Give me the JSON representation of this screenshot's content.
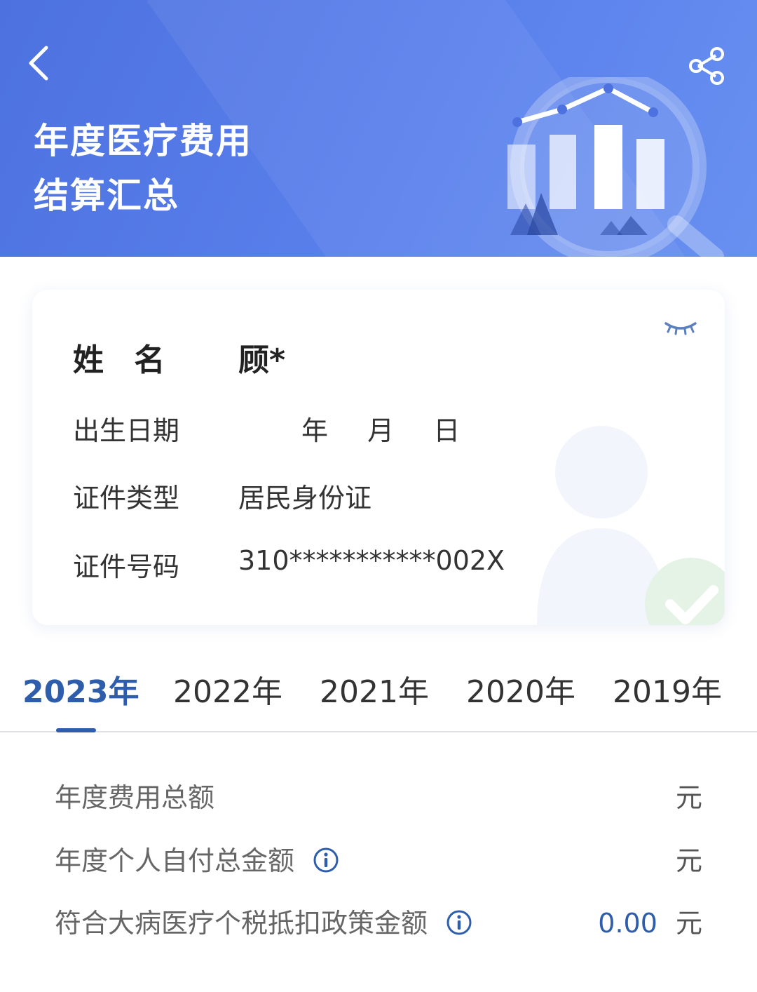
{
  "header": {
    "title_line1": "年度医疗费用",
    "title_line2": "结算汇总",
    "back_icon": "chevron-left-icon",
    "share_icon": "share-icon"
  },
  "profile": {
    "name_label": "姓 名",
    "name_value": "顾*",
    "birth_label": "出生日期",
    "birth_year": "年",
    "birth_month": "月",
    "birth_day": "日",
    "id_type_label": "证件类型",
    "id_type_value": "居民身份证",
    "id_number_label": "证件号码",
    "id_number_value": "310***********002X",
    "visibility_icon": "eye-closed-icon"
  },
  "tabs": [
    {
      "label": "2023年",
      "active": true
    },
    {
      "label": "2022年",
      "active": false
    },
    {
      "label": "2021年",
      "active": false
    },
    {
      "label": "2020年",
      "active": false
    },
    {
      "label": "2019年",
      "active": false
    }
  ],
  "summary": [
    {
      "label": "年度费用总额",
      "amount": "",
      "unit": "元",
      "has_info": false
    },
    {
      "label": "年度个人自付总金额",
      "amount": "",
      "unit": "元",
      "has_info": true
    },
    {
      "label": "符合大病医疗个税抵扣政策金额",
      "amount": "0.00",
      "unit": "元",
      "has_info": true
    }
  ],
  "colors": {
    "header_bg": "#5379e6",
    "accent": "#2e5dab",
    "card_bg": "#ffffff",
    "text": "#333333",
    "muted": "#666666"
  }
}
